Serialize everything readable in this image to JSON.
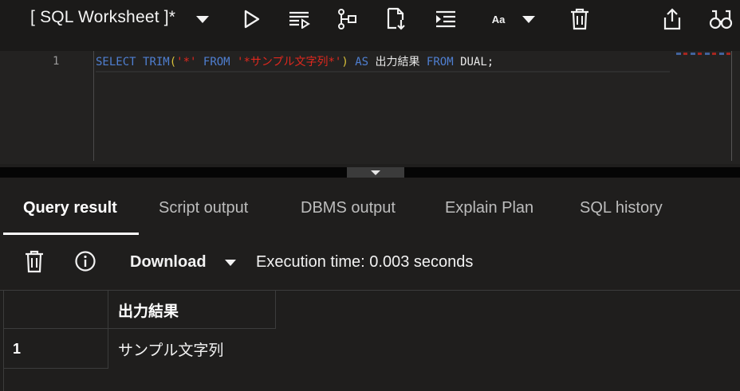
{
  "toolbar": {
    "worksheet_title": "[ SQL Worksheet ]*",
    "font_size_label": "Aa",
    "icons": [
      "chevron-down-icon",
      "run-statement-icon",
      "run-script-icon",
      "explain-plan-icon",
      "autotrace-icon",
      "format-icon",
      "font-size-icon",
      "clear-icon",
      "share-icon",
      "find-icon"
    ]
  },
  "editor": {
    "line_number": "1",
    "code": {
      "t1": "SELECT",
      "t2": " ",
      "t3": "TRIM",
      "t4": "(",
      "t5": "'*'",
      "t6": " FROM ",
      "t7": "'*サンプル文字列*'",
      "t8": ")",
      "t9": " AS ",
      "t10": "出力結果",
      "t11": " FROM ",
      "t12": "DUAL;"
    }
  },
  "result_tabs": [
    {
      "label": "Query result",
      "active": true
    },
    {
      "label": "Script output",
      "active": false
    },
    {
      "label": "DBMS output",
      "active": false
    },
    {
      "label": "Explain Plan",
      "active": false
    },
    {
      "label": "SQL history",
      "active": false
    }
  ],
  "result_toolbar": {
    "download_label": "Download",
    "execution_time": "Execution time: 0.003 seconds"
  },
  "result_grid": {
    "columns": [
      "出力結果"
    ],
    "rows": [
      {
        "num": "1",
        "values": [
          "サンプル文字列"
        ]
      }
    ]
  },
  "colors": {
    "keyword": "#4f7fd1",
    "string": "#e0281e",
    "paren": "#d9c13a",
    "background": "#1f1e1d"
  }
}
